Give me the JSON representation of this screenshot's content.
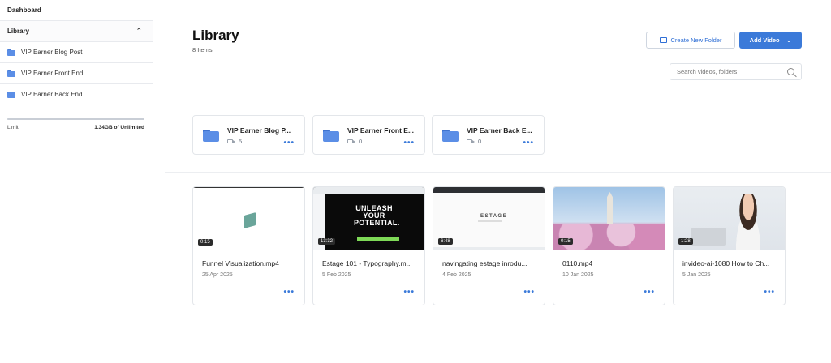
{
  "sidebar": {
    "dashboard": "Dashboard",
    "library": "Library",
    "items": [
      {
        "label": "VIP Earner Blog Post"
      },
      {
        "label": "VIP Earner Front End"
      },
      {
        "label": "VIP Earner Back End"
      }
    ],
    "limit_label": "Limit",
    "limit_value": "1.34GB of Unlimited"
  },
  "header": {
    "title": "Library",
    "count": "8 Items",
    "create_folder": "Create New Folder",
    "add_video": "Add Video",
    "search_placeholder": "Search videos, folders"
  },
  "folders": [
    {
      "name": "VIP Earner Blog P...",
      "count": "5"
    },
    {
      "name": "VIP Earner Front E...",
      "count": "0"
    },
    {
      "name": "VIP Earner Back E...",
      "count": "0"
    }
  ],
  "videos": [
    {
      "title": "Funnel Visualization.mp4",
      "date": "25 Apr 2025",
      "duration": "0:15"
    },
    {
      "title": "Estage 101 - Typography.m...",
      "date": "5 Feb 2025",
      "duration": "13:32",
      "thumb_text": "UNLEASH YOUR POTENTIAL."
    },
    {
      "title": "navingating estage inrodu...",
      "date": "4 Feb 2025",
      "duration": "6:48",
      "thumb_text": "ESTAGE"
    },
    {
      "title": "0110.mp4",
      "date": "10 Jan 2025",
      "duration": "0:15"
    },
    {
      "title": "invideo-ai-1080 How to Ch...",
      "date": "5 Jan 2025",
      "duration": "1:28"
    }
  ],
  "icons": [
    "folder-icon",
    "video-icon",
    "search-icon",
    "chevron-up-icon",
    "chevron-down-icon",
    "more-icon"
  ],
  "colors": {
    "accent": "#3b7ad9",
    "folder": "#5b8ee6"
  }
}
